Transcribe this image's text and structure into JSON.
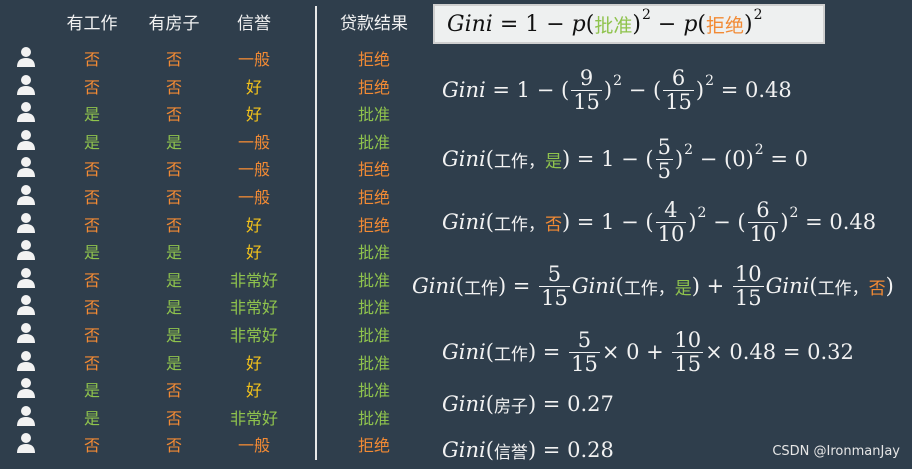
{
  "table": {
    "headers": [
      "有工作",
      "有房子",
      "信誉",
      "贷款结果"
    ],
    "rows": [
      [
        "否",
        "否",
        "一般",
        "拒绝"
      ],
      [
        "否",
        "否",
        "好",
        "拒绝"
      ],
      [
        "是",
        "否",
        "好",
        "批准"
      ],
      [
        "是",
        "是",
        "一般",
        "批准"
      ],
      [
        "否",
        "否",
        "一般",
        "拒绝"
      ],
      [
        "否",
        "否",
        "一般",
        "拒绝"
      ],
      [
        "否",
        "否",
        "好",
        "拒绝"
      ],
      [
        "是",
        "是",
        "好",
        "批准"
      ],
      [
        "否",
        "是",
        "非常好",
        "批准"
      ],
      [
        "否",
        "是",
        "非常好",
        "批准"
      ],
      [
        "否",
        "是",
        "非常好",
        "批准"
      ],
      [
        "否",
        "是",
        "好",
        "批准"
      ],
      [
        "是",
        "否",
        "好",
        "批准"
      ],
      [
        "是",
        "否",
        "非常好",
        "批准"
      ],
      [
        "否",
        "否",
        "一般",
        "拒绝"
      ]
    ],
    "colors": {
      "是": "#8fc34d",
      "否": "#f28a34",
      "一般": "#f28a34",
      "好": "#f3c21b",
      "非常好": "#8fc34d",
      "批准": "#8fc34d",
      "拒绝": "#f28a34"
    },
    "person_icon": "person-icon"
  },
  "formulas": {
    "gini": "Gini",
    "approve": "批准",
    "reject": "拒绝",
    "work": "工作",
    "yes": "是",
    "no": "否",
    "house": "房子",
    "credit": "信誉",
    "comma": "，",
    "f1_result": "0.48",
    "f2_result": "0",
    "f3_result": "0.48",
    "f5_result": "0.32",
    "house_result": "0.27",
    "credit_result": "0.28"
  },
  "watermark": "CSDN @IronmanJay"
}
